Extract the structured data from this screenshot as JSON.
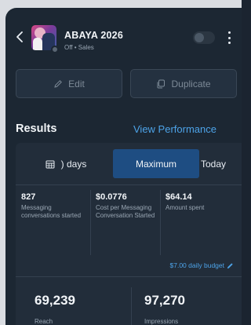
{
  "header": {
    "title": "ABAYA 2026",
    "subtitle": "Off • Sales"
  },
  "actions": {
    "edit_label": "Edit",
    "duplicate_label": "Duplicate"
  },
  "results": {
    "heading": "Results",
    "view_performance": "View Performance",
    "tabs": [
      {
        "label": ") days"
      },
      {
        "label": "Maximum"
      },
      {
        "label": "Today"
      }
    ],
    "metrics": [
      {
        "value": "827",
        "label": "Messaging conversations started"
      },
      {
        "value": "$0.0776",
        "label": "Cost per Messaging Conversation Started"
      },
      {
        "value": "$64.14",
        "label": "Amount spent"
      }
    ],
    "budget": "$7.00 daily budget",
    "totals": [
      {
        "value": "69,239",
        "label": "Reach"
      },
      {
        "value": "97,270",
        "label": "Impressions"
      }
    ]
  },
  "colors": {
    "accent": "#4da3e8",
    "selected_tab": "#1e4d82",
    "background": "#1c2733"
  },
  "icons": [
    "back-arrow-icon",
    "more-options-icon",
    "pencil-icon",
    "duplicate-icon",
    "calendar-icon",
    "edit-pencil-icon"
  ]
}
